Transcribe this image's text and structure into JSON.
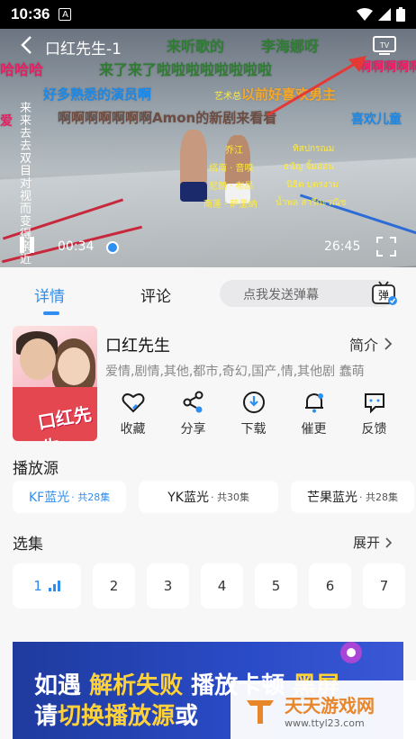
{
  "status": {
    "time": "10:36",
    "notif_letter": "A"
  },
  "player": {
    "title": "口红先生-1",
    "current_time": "00:34",
    "total_time": "26:45",
    "progress": 0.021,
    "danmaku": [
      {
        "text": "来听歌的",
        "color": "#2e7d32"
      },
      {
        "text": "李海娜呀",
        "color": "#2e7d32"
      },
      {
        "text": "哈哈哈",
        "color": "#e91e63"
      },
      {
        "text": "来了来了啦啦啦啦啦啦啦啦",
        "color": "#2e7d32"
      },
      {
        "text": "啊啊啊啊啊",
        "color": "#e91e63"
      },
      {
        "text": "好多熟悉的演员啊",
        "color": "#1e88e5"
      },
      {
        "text": "以前好喜欢男主",
        "color": "#f9a825"
      },
      {
        "text": "啊啊啊啊啊啊啊Amon的新剧来看看",
        "color": "#6d4c41"
      },
      {
        "text": "爱",
        "color": "#e91e63"
      },
      {
        "text": "喜欢儿童",
        "color": "#1e88e5"
      }
    ],
    "vertical_text": "来来去去双目对视而变得亲近",
    "subtitles": [
      "艺术总",
      "乔江",
      "络南 · 音嗅",
      "尼朗 · 布昂",
      "南蓬 · 萨里纳",
      "ทิสปกรณม",
      "ธนัญ จิ้มอ่อน",
      "นิธิต บุตรงาม",
      "น้ำพล สารีกะวณิช"
    ]
  },
  "tabs": {
    "details": "详情",
    "comments": "评论",
    "danmaku_placeholder": "点我发送弹幕",
    "danmaku_toggle": "弹"
  },
  "show": {
    "title": "口红先生",
    "intro": "简介",
    "genres": "爱情,剧情,其他,都市,奇幻,国产,情,其他剧 蠢萌",
    "poster_text": "口红先生"
  },
  "actions": [
    {
      "label": "收藏",
      "icon": "heart-icon"
    },
    {
      "label": "分享",
      "icon": "share-icon"
    },
    {
      "label": "下载",
      "icon": "download-icon"
    },
    {
      "label": "催更",
      "icon": "bell-icon"
    },
    {
      "label": "反馈",
      "icon": "feedback-icon"
    }
  ],
  "sources": {
    "title": "播放源",
    "items": [
      {
        "name": "KF蓝光",
        "count": "· 共28集"
      },
      {
        "name": "YK蓝光",
        "count": "· 共30集"
      },
      {
        "name": "芒果蓝光",
        "count": "· 共28集"
      }
    ]
  },
  "episodes": {
    "title": "选集",
    "expand": "展开",
    "items": [
      "1",
      "2",
      "3",
      "4",
      "5",
      "6",
      "7"
    ]
  },
  "banner": {
    "line1_a": "如遇",
    "line1_b": "解析失败",
    "line1_c": "播放卡顿",
    "line1_d": "黑屏",
    "line2_a": "请",
    "line2_b": "切换播放源",
    "line2_c": "或"
  },
  "watermark": {
    "name": "天天游戏网",
    "url": "www.ttyl23.com"
  },
  "colors": {
    "accent": "#2f8ef0",
    "annotation_arrow": "#e53935"
  }
}
